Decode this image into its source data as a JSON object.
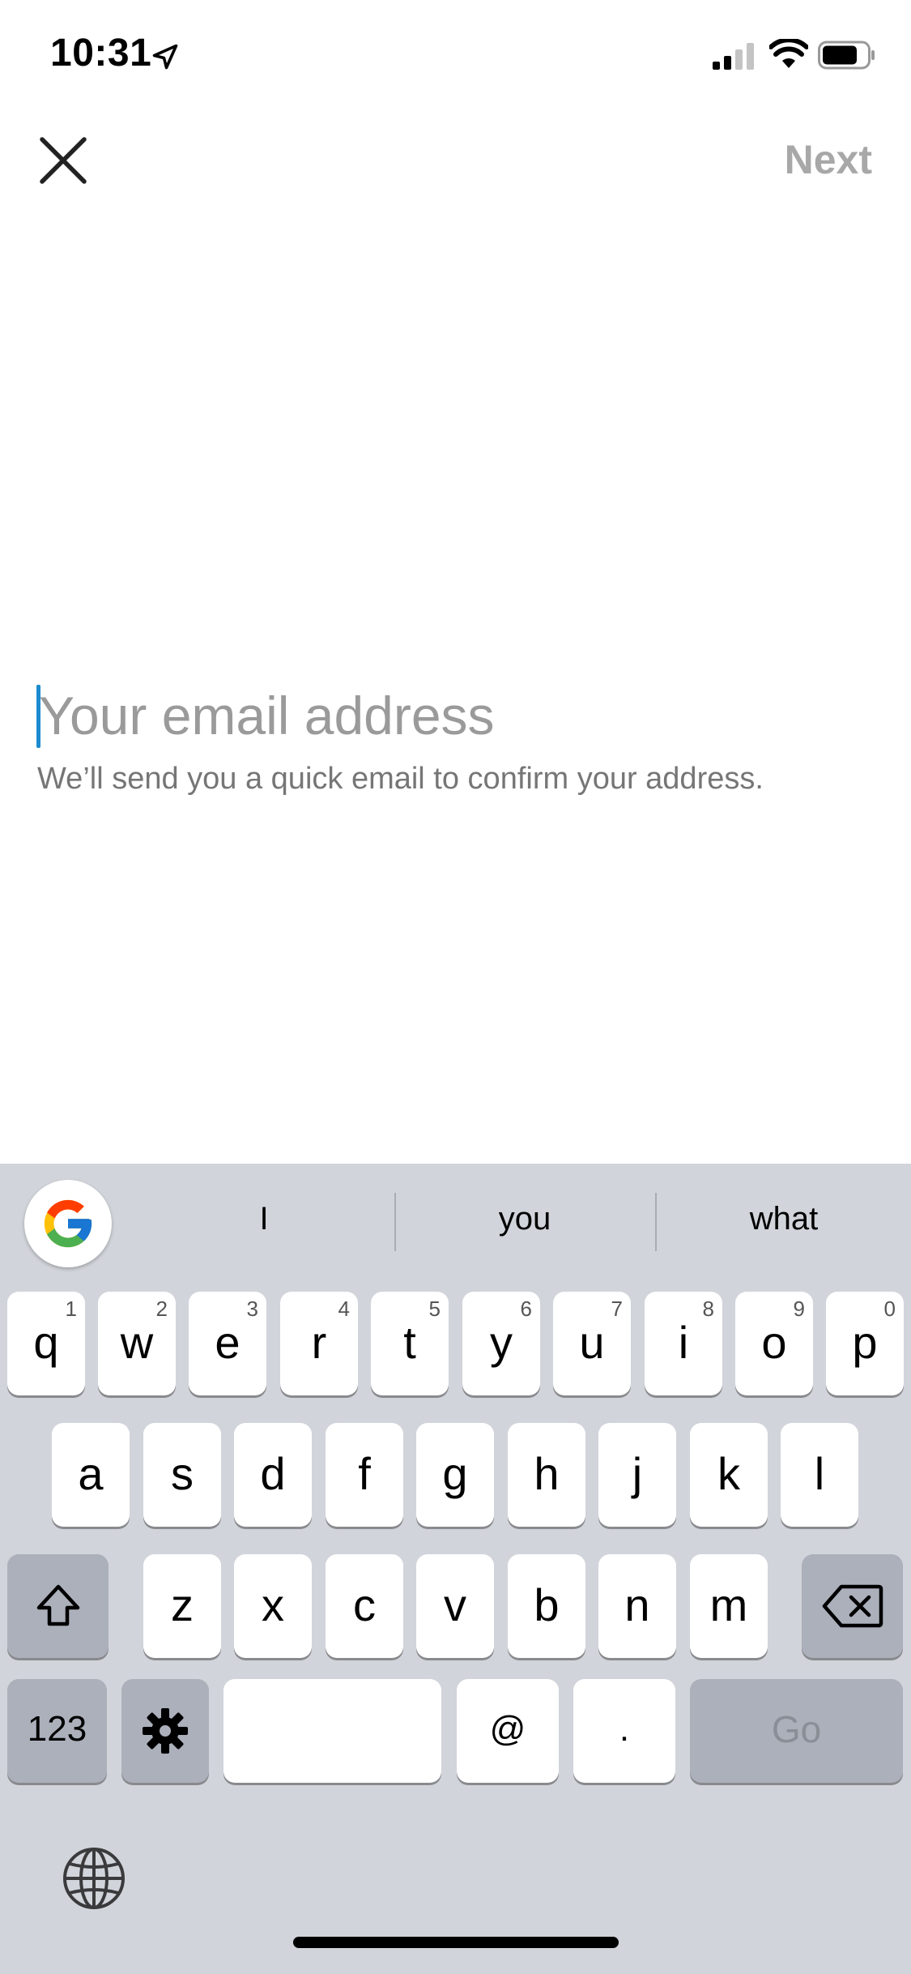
{
  "status_bar": {
    "time": "10:31",
    "icons": [
      "location-arrow-icon",
      "signal-icon",
      "wifi-icon",
      "battery-icon"
    ]
  },
  "nav": {
    "close_icon": "close-icon",
    "next_label": "Next"
  },
  "email": {
    "placeholder": "Your email address",
    "value": "",
    "helper": "We’ll send you a quick email to confirm your address."
  },
  "keyboard": {
    "suggestions": [
      "I",
      "you",
      "what"
    ],
    "row1": [
      {
        "label": "q",
        "num": "1"
      },
      {
        "label": "w",
        "num": "2"
      },
      {
        "label": "e",
        "num": "3"
      },
      {
        "label": "r",
        "num": "4"
      },
      {
        "label": "t",
        "num": "5"
      },
      {
        "label": "y",
        "num": "6"
      },
      {
        "label": "u",
        "num": "7"
      },
      {
        "label": "i",
        "num": "8"
      },
      {
        "label": "o",
        "num": "9"
      },
      {
        "label": "p",
        "num": "0"
      }
    ],
    "row2": [
      "a",
      "s",
      "d",
      "f",
      "g",
      "h",
      "j",
      "k",
      "l"
    ],
    "row3": [
      "z",
      "x",
      "c",
      "v",
      "b",
      "n",
      "m"
    ],
    "numbers_label": "123",
    "at_label": "@",
    "dot_label": ".",
    "go_label": "Go",
    "icons": [
      "google-icon",
      "shift-icon",
      "delete-icon",
      "settings-gear-icon",
      "globe-icon"
    ]
  },
  "colors": {
    "cursor": "#1d8ccf",
    "next_disabled": "#a8a8a8",
    "keyboard_bg": "#d1d4da"
  }
}
